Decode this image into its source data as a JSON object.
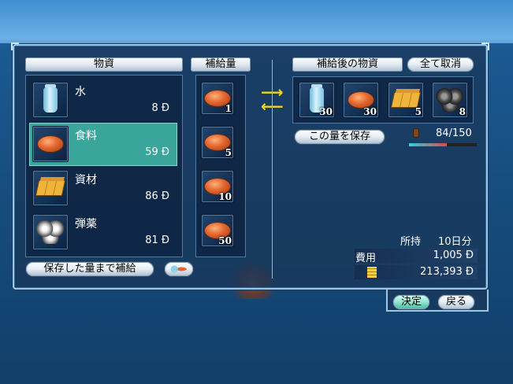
{
  "goods_panel": {
    "header": "物資",
    "items": [
      {
        "name": "水",
        "qty": "8 Ð",
        "icon": "water-bottle-icon",
        "selected": false
      },
      {
        "name": "食料",
        "qty": "59 Ð",
        "icon": "bread-icon",
        "selected": true
      },
      {
        "name": "資材",
        "qty": "86 Ð",
        "icon": "lumber-icon",
        "selected": false
      },
      {
        "name": "弾薬",
        "qty": "81 Ð",
        "icon": "cannonball-icon",
        "selected": false
      }
    ],
    "resupply_saved_button": "保存した量まで補給"
  },
  "supply_panel": {
    "header": "補給量",
    "amounts": [
      "1",
      "5",
      "10",
      "50"
    ]
  },
  "after_panel": {
    "header": "補給後の物資",
    "cancel_all_button": "全て取消",
    "items": [
      {
        "icon": "water-bottle-icon",
        "count": "30"
      },
      {
        "icon": "bread-icon",
        "count": "30"
      },
      {
        "icon": "lumber-icon",
        "count": "5"
      },
      {
        "icon": "cannonball-icon",
        "count": "8"
      }
    ],
    "save_amount_button": "この量を保存",
    "capacity": "84/150",
    "capacity_fraction": 0.56
  },
  "summary": {
    "holding_label": "所持",
    "holding_value": "10日分",
    "cost_label": "費用",
    "cost_value": "1,005 Ð",
    "gold_value": "213,393 Ð"
  },
  "footer": {
    "confirm_button": "決定",
    "back_button": "戻る"
  }
}
